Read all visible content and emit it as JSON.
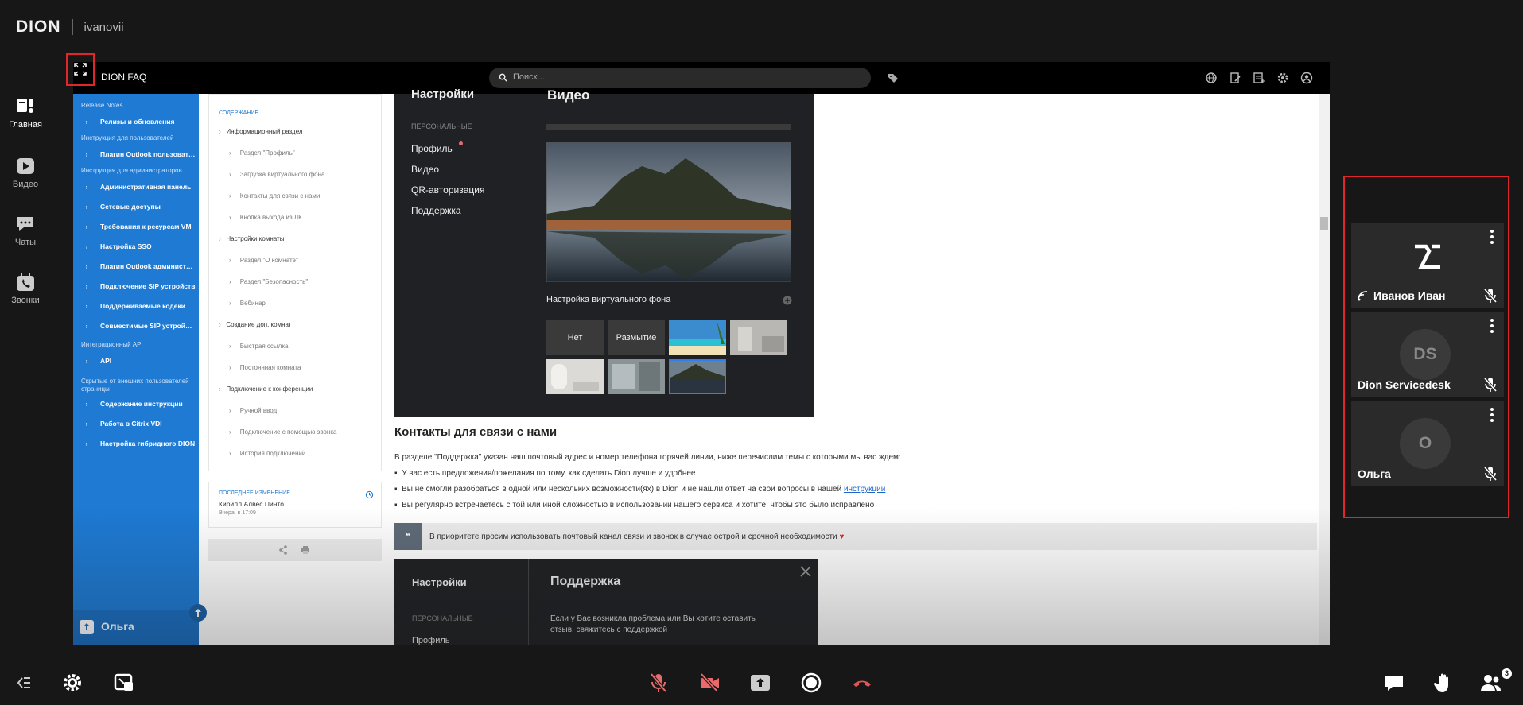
{
  "brand": {
    "logo": "DION",
    "username": "ivanovii"
  },
  "nav": [
    {
      "label": "Главная",
      "icon": "home-icon",
      "active": true
    },
    {
      "label": "Видео",
      "icon": "video-play-icon"
    },
    {
      "label": "Чаты",
      "icon": "chat-icon"
    },
    {
      "label": "Звонки",
      "icon": "calendar-icon"
    }
  ],
  "window": {
    "title": "DION FAQ",
    "search_placeholder": "Поиск..."
  },
  "bluenav": {
    "sections": [
      "Release Notes",
      "Инструкция для пользователей",
      "Инструкция для администраторов",
      "Интеграционный API",
      "Скрытые от внешних пользователей страницы"
    ],
    "items": [
      "Релизы и обновления",
      "Плагин Outlook пользовател...",
      "Административная панель",
      "Сетевые доступы",
      "Требования к ресурсам VM",
      "Настройка SSO",
      "Плагин Outlook администрат...",
      "Подключение SIP устройств",
      "Поддерживаемые кодеки",
      "Совместимые SIP устройства",
      "API",
      "Содержание инструкции",
      "Работа в Citrix VDI",
      "Настройка гибридного DION"
    ],
    "presenter": "Ольга"
  },
  "toc": {
    "header": "СОДЕРЖАНИЕ",
    "items": [
      "Информационный раздел",
      "Раздел \"Профиль\"",
      "Загрузка виртуального фона",
      "Контакты для связи с нами",
      "Кнопка выхода из ЛК",
      "Настройки комнаты",
      "Раздел \"О комнате\"",
      "Раздел \"Безопасность\"",
      "Вебинар",
      "Создание доп. комнат",
      "Быстрая ссылка",
      "Постоянная комната",
      "Подключение к конференции",
      "Ручной ввод",
      "Подключение с помощью звонка",
      "История подключений"
    ]
  },
  "lastchange": {
    "label": "ПОСЛЕДНЕЕ ИЗМЕНЕНИЕ",
    "author": "Кирилл Алвес Пинто",
    "date": "Вчера, в 17:09"
  },
  "shot1": {
    "title_left": "Настройки",
    "title_right": "Видео",
    "section": "ПЕРСОНАЛЬНЫЕ",
    "menu": [
      "Профиль",
      "Видео",
      "QR-авторизация",
      "Поддержка"
    ],
    "bg_title": "Настройка виртуального фона",
    "opt_none": "Нет",
    "opt_blur": "Размытие"
  },
  "article": {
    "heading": "Контакты для связи с нами",
    "intro": "В разделе \"Поддержка\" указан наш почтовый адрес и номер телефона горячей линии, ниже перечислим темы с которыми мы вас ждем:",
    "bullets": [
      "У вас есть предложения/пожелания по тому, как сделать Dion лучше и удобнее",
      "Вы не смогли разобраться в одной или нескольких возможности(ях) в Dion и не нашли ответ на свои вопросы в нашей",
      "Вы регулярно встречаетесь с той или иной сложностью в использовании нашего сервиса и хотите, чтобы это было исправлено"
    ],
    "link": "инструкции",
    "quote": "В приоритете просим использовать почтовый канал связи и звонок в случае острой и срочной необходимости"
  },
  "shot2": {
    "title_left": "Настройки",
    "title_right": "Поддержка",
    "section": "ПЕРСОНАЛЬНЫЕ",
    "menu_first": "Профиль",
    "text1": "Если у Вас возникла проблема или Вы хотите оставить",
    "text2": "отзыв, свяжитесь с поддержкой"
  },
  "participants": [
    {
      "name": "Иванов Иван",
      "avatar": "",
      "sharing": true
    },
    {
      "name": "Dion Servicedesk",
      "avatar": "DS"
    },
    {
      "name": "Ольга",
      "avatar": "О"
    }
  ],
  "bottombar": {
    "participants_count": "3"
  },
  "colors": {
    "accent_red": "#e0262a",
    "blue_nav": "#1e7ad3",
    "bg": "#171717",
    "mute_red": "#e86a6a"
  }
}
